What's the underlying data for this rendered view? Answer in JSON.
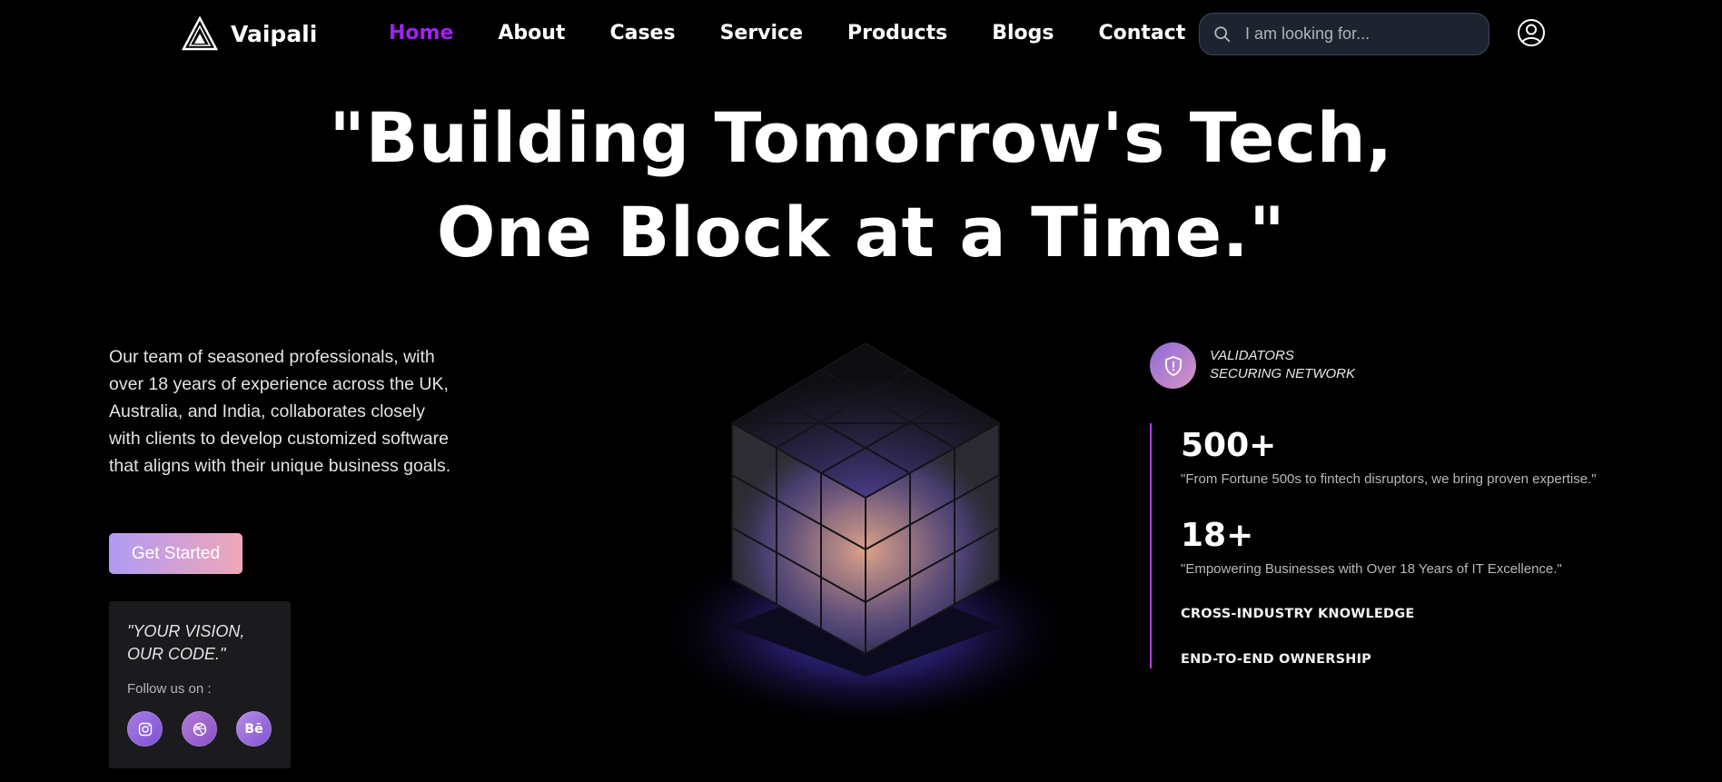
{
  "nav": {
    "brand": "Vaipali",
    "links": [
      "Home",
      "About",
      "Cases",
      "Service",
      "Products",
      "Blogs",
      "Contact"
    ],
    "active": "Home",
    "search_placeholder": "I am looking for...",
    "icons": {
      "search": "search-icon",
      "account": "user-circle-icon",
      "logo": "triangle-logo-icon"
    }
  },
  "hero": {
    "headline_line1": "\"Building Tomorrow's Tech,",
    "headline_line2": "One Block at a Time.\"",
    "intro": "Our team of seasoned professionals, with over 18 years of experience across the UK, Australia, and India, collaborates closely with clients to develop customized software that aligns with their unique business goals.",
    "cta": "Get Started"
  },
  "card": {
    "quote": "\"YOUR VISION, OUR CODE.\"",
    "follow": "Follow us on :",
    "socials": [
      {
        "icon": "instagram-icon"
      },
      {
        "icon": "dribbble-icon"
      },
      {
        "icon": "behance-icon",
        "text": "Bē"
      }
    ]
  },
  "stats": {
    "badge_line1": "VALIDATORS",
    "badge_line2": "SECURING NETWORK",
    "badge_icon": "shield-alert-icon",
    "items": [
      {
        "value": "500+",
        "desc": "\"From Fortune 500s to fintech disruptors, we bring proven expertise.\""
      },
      {
        "value": "18+",
        "desc": "\"Empowering Businesses with Over 18 Years of IT Excellence.\""
      }
    ],
    "tags": [
      "CROSS-INDUSTRY KNOWLEDGE",
      "END-TO-END OWNERSHIP"
    ]
  },
  "colors": {
    "background": "#000000",
    "active_link": "#9d23f0",
    "accent_line": "#b63fd9",
    "cta_gradient_start": "#b09af5",
    "cta_gradient_end": "#f0a7b8"
  }
}
